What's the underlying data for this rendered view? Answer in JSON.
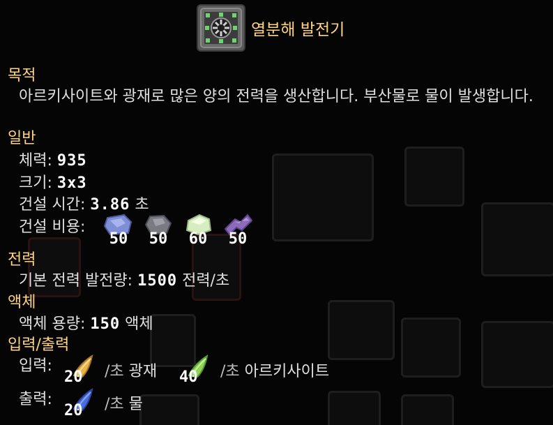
{
  "block": {
    "name": "열분해 발전기",
    "icon": "pyrolysis-generator-icon"
  },
  "sections": {
    "purpose": {
      "title": "목적",
      "description": "아르키사이트와 광재로 많은 양의 전력을 생산합니다. 부산물로 물이 발생합니다."
    },
    "general": {
      "title": "일반",
      "health_label": "체력:",
      "health_value": "935",
      "size_label": "크기:",
      "size_value": "3x3",
      "build_time_label": "건설 시간:",
      "build_time_value": "3.86",
      "build_time_unit": "초",
      "build_cost_label": "건설 비용:",
      "build_cost": [
        {
          "icon": "graphite-icon",
          "amount": "50"
        },
        {
          "icon": "tungsten-icon",
          "amount": "50"
        },
        {
          "icon": "oxide-icon",
          "amount": "60"
        },
        {
          "icon": "carbide-icon",
          "amount": "50"
        }
      ]
    },
    "power": {
      "title": "전력",
      "label": "기본 전력 발전량:",
      "value": "1500",
      "unit": "전력/초"
    },
    "liquid": {
      "title": "액체",
      "label": "액체 용량:",
      "value": "150",
      "unit": "액체"
    },
    "io": {
      "title": "입력/출력",
      "input_label": "입력:",
      "inputs": [
        {
          "icon": "slag-icon",
          "amount": "20",
          "rate": "/초",
          "name": "광재"
        },
        {
          "icon": "arkycite-icon",
          "amount": "40",
          "rate": "/초",
          "name": "아르키사이트"
        }
      ],
      "output_label": "출력:",
      "outputs": [
        {
          "icon": "water-icon",
          "amount": "20",
          "rate": "/초",
          "name": "물"
        }
      ]
    }
  },
  "colors": {
    "section_title": "#ffd37f",
    "text": "#e0e0e0",
    "background": "#050505"
  }
}
